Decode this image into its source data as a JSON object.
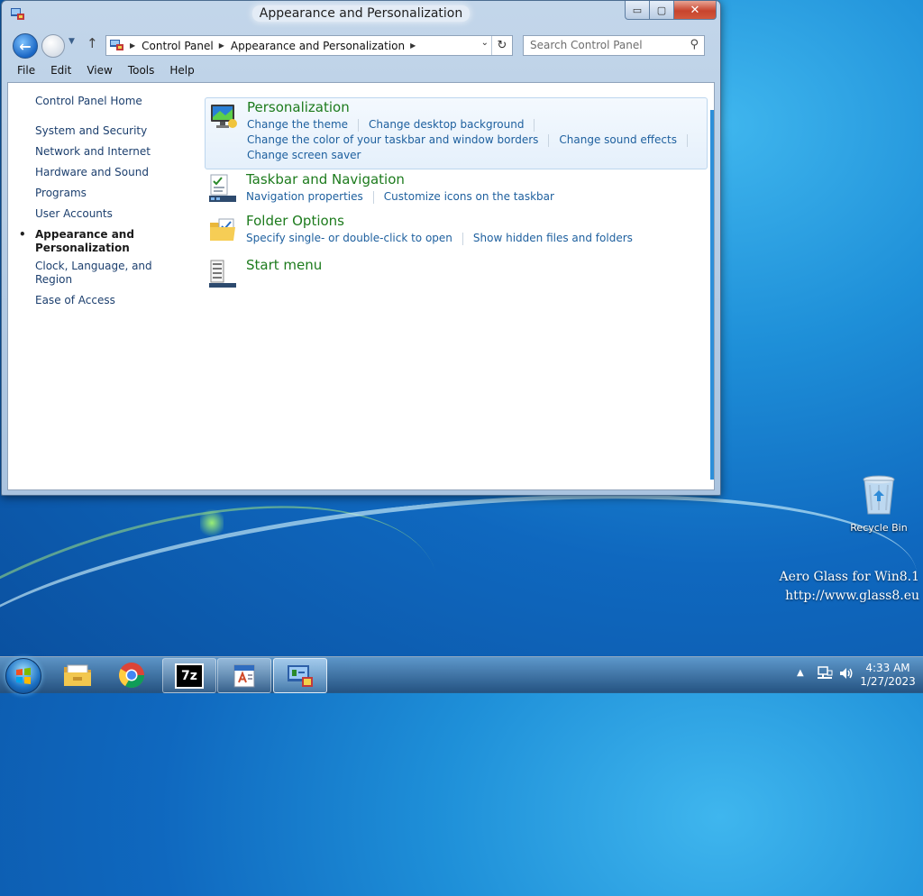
{
  "window": {
    "title": "Appearance and Personalization",
    "buttons": {
      "minimize": "▭",
      "maximize": "▢",
      "close": "✕"
    }
  },
  "navbar": {
    "back_glyph": "←",
    "up_glyph": "↑",
    "history_glyph": "▼",
    "breadcrumbs": [
      "Control Panel",
      "Appearance and Personalization"
    ],
    "separator": "▶",
    "dropdown_glyph": "⌄",
    "refresh_glyph": "↻",
    "search_placeholder": "Search Control Panel",
    "search_glyph": "⚲"
  },
  "menubar": [
    "File",
    "Edit",
    "View",
    "Tools",
    "Help"
  ],
  "sidebar": {
    "home": "Control Panel Home",
    "items": [
      "System and Security",
      "Network and Internet",
      "Hardware and Sound",
      "Programs",
      "User Accounts",
      "Appearance and Personalization",
      "Clock, Language, and Region",
      "Ease of Access"
    ],
    "active": "Appearance and Personalization",
    "bullet": "•"
  },
  "categories": [
    {
      "title": "Personalization",
      "icon": "personalization-icon",
      "links": [
        [
          "Change the theme",
          "Change desktop background"
        ],
        [
          "Change the color of your taskbar and window borders",
          "Change sound effects"
        ],
        [
          "Change screen saver"
        ]
      ]
    },
    {
      "title": "Taskbar and Navigation",
      "icon": "taskbar-icon",
      "links": [
        [
          "Navigation properties",
          "Customize icons on the taskbar"
        ]
      ]
    },
    {
      "title": "Folder Options",
      "icon": "folder-options-icon",
      "links": [
        [
          "Specify single- or double-click to open",
          "Show hidden files and folders"
        ]
      ]
    },
    {
      "title": "Start menu",
      "icon": "start-menu-icon",
      "links": []
    }
  ],
  "desktop": {
    "recycle_bin": "Recycle Bin",
    "watermark_line1": "Aero Glass for Win8.1",
    "watermark_line2": "http://www.glass8.eu"
  },
  "taskbar": {
    "apps": [
      "file-explorer-icon",
      "chrome-icon",
      "7zip-icon",
      "wordpad-icon",
      "control-panel-icon"
    ],
    "sevenzip_label": "7z",
    "tray_arrow": "▲",
    "time": "4:33 AM",
    "date": "1/27/2023"
  },
  "colors": {
    "link": "#1d5f9e",
    "category_title": "#1d7b1d",
    "desktop": "#1e8fd8"
  }
}
